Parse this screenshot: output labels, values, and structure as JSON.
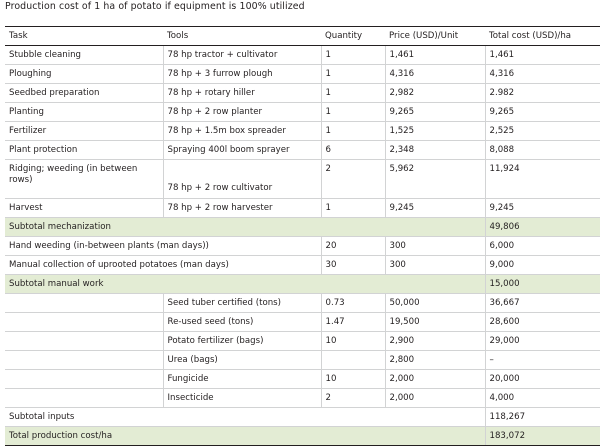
{
  "caption": "Production cost of 1 ha of potato if equipment is 100% utilized",
  "table": {
    "headers": [
      "Task",
      "Tools",
      "Quantity",
      "Price (USD)/Unit",
      "Total cost (USD)/ha"
    ],
    "mechanization": [
      {
        "task": "Stubble cleaning",
        "tools": "78 hp tractor + cultivator",
        "qty": "1",
        "price": "1,461",
        "total": "1,461"
      },
      {
        "task": "Ploughing",
        "tools": "78 hp + 3 furrow plough",
        "qty": "1",
        "price": "4,316",
        "total": "4,316"
      },
      {
        "task": "Seedbed preparation",
        "tools": "78 hp + rotary hiller",
        "qty": "1",
        "price": "2,982",
        "total": "2.982"
      },
      {
        "task": "Planting",
        "tools": "78 hp + 2 row planter",
        "qty": "1",
        "price": "9,265",
        "total": "9,265"
      },
      {
        "task": "Fertilizer",
        "tools": "78 hp + 1.5m box spreader",
        "qty": "1",
        "price": "1,525",
        "total": "2,525"
      },
      {
        "task": "Plant protection",
        "tools": "Spraying 400l boom sprayer",
        "qty": "6",
        "price": "2,348",
        "total": "8,088"
      },
      {
        "task": "Ridging; weeding (in between rows)",
        "tools": "78 hp + 2 row cultivator",
        "qty": "2",
        "price": "5,962",
        "total": "11,924"
      },
      {
        "task": "Harvest",
        "tools": "78 hp + 2 row harvester",
        "qty": "1",
        "price": "9,245",
        "total": "9,245"
      }
    ],
    "subtotal_mechanization": {
      "label": "Subtotal mechanization",
      "total": "49,806"
    },
    "manual": [
      {
        "task": "Hand weeding (in-between plants (man days))",
        "qty": "20",
        "price": "300",
        "total": "6,000"
      },
      {
        "task": "Manual collection of uprooted potatoes (man days)",
        "qty": "30",
        "price": "300",
        "total": "9,000"
      }
    ],
    "subtotal_manual": {
      "label": "Subtotal manual work",
      "total": "15,000"
    },
    "inputs": [
      {
        "item": "Seed tuber certified (tons)",
        "qty": "0.73",
        "price": "50,000",
        "total": "36,667"
      },
      {
        "item": "Re-used seed (tons)",
        "qty": "1.47",
        "price": "19,500",
        "total": "28,600"
      },
      {
        "item": "Potato fertilizer (bags)",
        "qty": "10",
        "price": "2,900",
        "total": "29,000"
      },
      {
        "item": "Urea (bags)",
        "qty": "",
        "price": "2,800",
        "total": "–"
      },
      {
        "item": "Fungicide",
        "qty": "10",
        "price": "2,000",
        "total": "20,000"
      },
      {
        "item": "Insecticide",
        "qty": "2",
        "price": "2,000",
        "total": "4,000"
      }
    ],
    "subtotal_inputs": {
      "label": "Subtotal inputs",
      "total": "118,267"
    },
    "total_production": {
      "label": "Total production cost/ha",
      "total": "183,072"
    }
  }
}
